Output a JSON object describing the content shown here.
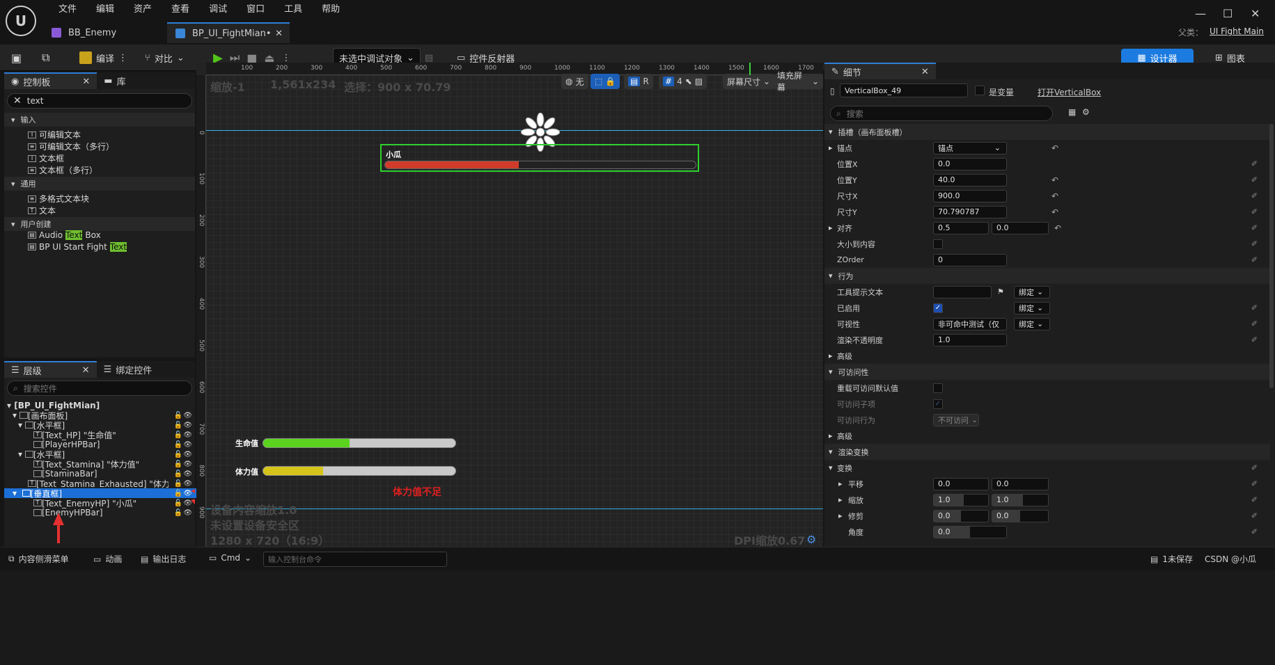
{
  "app": {
    "parent_label": "父类：",
    "parent_value": "UI Fight Main"
  },
  "menu": [
    "文件",
    "编辑",
    "资产",
    "查看",
    "调试",
    "窗口",
    "工具",
    "帮助"
  ],
  "tabs": [
    {
      "label": "BB_Enemy"
    },
    {
      "label": "BP_UI_FightMian•"
    }
  ],
  "toolbar": {
    "compile": "编译",
    "diff": "对比",
    "debug_target": "未选中调试对象",
    "widget_reflector": "控件反射器",
    "designer": "设计器",
    "graph": "图表"
  },
  "palette": {
    "tab_palette": "控制板",
    "tab_library": "库",
    "search_value": "text",
    "categories": [
      {
        "label": "输入",
        "items": [
          "可编辑文本",
          "可编辑文本（多行）",
          "文本框",
          "文本框（多行）"
        ]
      },
      {
        "label": "通用",
        "items": [
          "多格式文本块",
          "文本"
        ]
      },
      {
        "label": "用户创建",
        "items": [
          {
            "pre": "Audio ",
            "hl": "Text",
            "post": " Box"
          },
          {
            "pre": "BP UI Start Fight ",
            "hl": "Text",
            "post": ""
          }
        ]
      }
    ]
  },
  "hierarchy": {
    "tab_hierarchy": "层级",
    "tab_bind": "绑定控件",
    "search_placeholder": "搜索控件",
    "rows": [
      "[BP_UI_FightMian]",
      "[画布面板]",
      "[水平框]",
      "[Text_HP] \"生命值\"",
      "[PlayerHPBar]",
      "[水平框]",
      "[Text_Stamina] \"体力值\"",
      "[StaminaBar]",
      "[Text_Stamina_Exhausted] \"体力值不足\"",
      "[垂直框]",
      "[Text_EnemyHP] \"小瓜\"",
      "[EnemyHPBar]"
    ]
  },
  "canvas": {
    "zoom": "缩放-1",
    "size": "1,561x234",
    "selection": "选择：900 x 70.79",
    "ctrl_none": "无",
    "ctrl_r": "R",
    "ctrl_4": "4",
    "screen_size": "屏幕尺寸",
    "fill_screen": "填充屏幕",
    "ruler_top": [
      "100",
      "200",
      "300",
      "400",
      "500",
      "600",
      "700",
      "800",
      "900",
      "1000",
      "1100",
      "1200",
      "1300",
      "1400",
      "1500",
      "1600",
      "1700"
    ],
    "ruler_left": [
      "0",
      "1 0 0",
      "2 0 0",
      "3 0 0",
      "4 0 0",
      "5 0 0",
      "6 0 0",
      "7 0 0",
      "8 0 0",
      "9 0 0",
      "1 0 0"
    ],
    "device_scale": "设备内容缩放1.0",
    "safe_zone": "未设置设备安全区",
    "resolution": "1280 x 720（16:9）",
    "dpi": "DPI缩放0.67",
    "enemy_label": "小瓜",
    "hp_label": "生命值",
    "stamina_label": "体力值",
    "exhausted": "体力值不足",
    "enemy_fill": 0.43,
    "hp_fill": 0.45,
    "stamina_fill": 0.31,
    "colors": {
      "enemy": "#d03b2b",
      "hp": "#5bd31e",
      "stamina": "#d6c41a",
      "exhausted": "#e02020"
    }
  },
  "details": {
    "tab": "细节",
    "name": "VerticalBox_49",
    "is_variable": "是变量",
    "open": "打开VerticalBox",
    "search_placeholder": "搜索",
    "sec_slot": "插槽（画布面板槽）",
    "anchor_label": "锚点",
    "anchor_value": "锚点",
    "pos_x_label": "位置X",
    "pos_x": "0.0",
    "pos_y_label": "位置Y",
    "pos_y": "40.0",
    "size_x_label": "尺寸X",
    "size_x": "900.0",
    "size_y_label": "尺寸Y",
    "size_y": "70.790787",
    "align_label": "对齐",
    "align_x": "0.5",
    "align_y": "0.0",
    "autosize_label": "大小到内容",
    "zorder_label": "ZOrder",
    "zorder": "0",
    "sec_behavior": "行为",
    "tooltip_label": "工具提示文本",
    "bind": "绑定",
    "enabled_label": "已启用",
    "visibility_label": "可视性",
    "visibility_value": "非可命中测试（仅",
    "opacity_label": "渲染不透明度",
    "opacity": "1.0",
    "advanced": "高级",
    "sec_access": "可访问性",
    "override_label": "重载可访问默认值",
    "children_label": "可访问子项",
    "behavior_label": "可访问行为",
    "behavior_value": "不可访问",
    "advanced2": "高级",
    "sec_render": "渲染变换",
    "transform_label": "变换",
    "translate_label": "平移",
    "tx": "0.0",
    "ty": "0.0",
    "scale_label": "缩放",
    "sx": "1.0",
    "sy": "1.0",
    "shear_label": "修剪",
    "shx": "0.0",
    "shy": "0.0",
    "angle_label": "角度",
    "angle": "0.0"
  },
  "status": {
    "content_drawer": "内容侧滑菜单",
    "anim": "动画",
    "output_log": "输出日志",
    "cmd": "Cmd",
    "cmd_placeholder": "输入控制台命令",
    "unsaved": "1未保存",
    "source": "CSDN @小瓜"
  }
}
